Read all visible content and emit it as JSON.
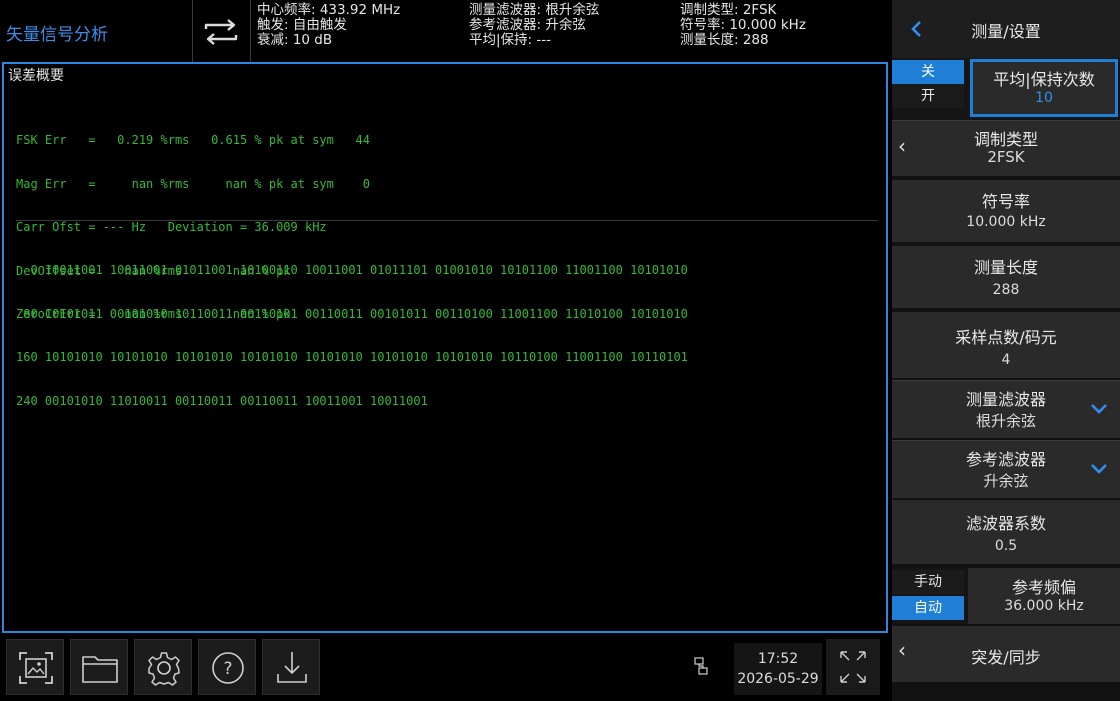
{
  "header": {
    "app_title": "矢量信号分析",
    "center_freq": "中心频率: 433.92 MHz",
    "trigger": "触发: 自由触发",
    "attenuation": "衰减: 10 dB",
    "meas_filter": "测量滤波器: 根升余弦",
    "ref_filter": "参考滤波器: 升余弦",
    "avg_hold": "平均|保持: ---",
    "mod_type": "调制类型: 2FSK",
    "symbol_rate": "符号率: 10.000 kHz",
    "meas_length": "测量长度: 288"
  },
  "pane": {
    "title": "误差概要",
    "error_lines": [
      "FSK Err   =   0.219 %rms   0.615 % pk at sym   44",
      "Mag Err   =     nan %rms     nan % pk at sym    0",
      "Carr Ofst = --- Hz   Deviation = 36.009 kHz",
      "DevOffset =    nan %rms       nan % pk",
      "ZeroCrErr =    nan %rms       nan % pk"
    ],
    "bit_lines": [
      "  0 10011001 10011001 01011001 10100110 10011001 01011101 01001010 10101100 11001100 10101010",
      " 80 10101011 00101010 10110011 00110101 00110011 00101011 00110100 11001100 11010100 10101010",
      "160 10101010 10101010 10101010 10101010 10101010 10101010 10101010 10110100 11001100 10110101",
      "240 00101010 11010011 00110011 00110011 10011001 10011001"
    ]
  },
  "toolbar": {
    "icons": [
      "screenshot-icon",
      "folder-icon",
      "gear-icon",
      "help-icon",
      "download-icon"
    ],
    "time": "17:52",
    "date": "2026-05-29"
  },
  "panel": {
    "back_title": "测量/设置",
    "avg_toggle_off": "关",
    "avg_toggle_on": "开",
    "avg_label": "平均|保持次数",
    "avg_value": "10",
    "mod_label": "调制类型",
    "mod_value": "2FSK",
    "symrate_label": "符号率",
    "symrate_value": "10.000 kHz",
    "length_label": "测量长度",
    "length_value": "288",
    "sps_label": "采样点数/码元",
    "sps_value": "4",
    "measfilter_label": "测量滤波器",
    "measfilter_value": "根升余弦",
    "reffilter_label": "参考滤波器",
    "reffilter_value": "升余弦",
    "filtercoef_label": "滤波器系数",
    "filtercoef_value": "0.5",
    "refdev_manual": "手动",
    "refdev_auto": "自动",
    "refdev_label": "参考频偏",
    "refdev_value": "36.000 kHz",
    "burst_label": "突发/同步"
  },
  "colors": {
    "accent": "#1f7fd6",
    "trace_green": "#37b837",
    "title_blue": "#3a8ee6"
  }
}
